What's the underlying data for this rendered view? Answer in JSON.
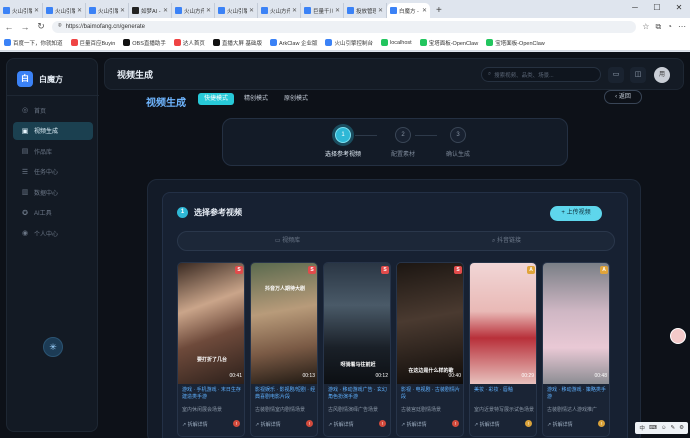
{
  "browser": {
    "tabs": [
      {
        "title": "火山引擎控制",
        "icon": "blue",
        "active": false
      },
      {
        "title": "火山引擎-你",
        "icon": "blue",
        "active": false
      },
      {
        "title": "火山引擎-你",
        "icon": "blue",
        "active": false
      },
      {
        "title": "如梦AI - 一站",
        "icon": "dark",
        "active": false
      },
      {
        "title": "火山方舟-火山",
        "icon": "blue",
        "active": false
      },
      {
        "title": "火山引擎控制",
        "icon": "blue",
        "active": false
      },
      {
        "title": "火山方舟 - A",
        "icon": "blue",
        "active": false
      },
      {
        "title": "巨量千川",
        "icon": "blue",
        "active": false
      },
      {
        "title": "投放管理",
        "icon": "blue",
        "active": false
      },
      {
        "title": "白魔方 - 电商",
        "icon": "blue",
        "active": true
      }
    ],
    "new_tab": "+",
    "url": "https://baimofang.cn/generate",
    "bookmarks": [
      "百度一下，你就知道",
      "巨量百应Buyin",
      "OBS直播助手",
      "达人首页",
      "直播大屏 基础版",
      "ArkClaw 企业版",
      "火山引擎控制台",
      "localhost",
      "宝塔面板-OpenClaw",
      "宝塔面板-OpenClaw"
    ]
  },
  "app": {
    "logo_letter": "白",
    "logo_name": "白魔方",
    "menu": [
      {
        "icon": "◎",
        "label": "首页",
        "active": false
      },
      {
        "icon": "▣",
        "label": "视频生成",
        "active": true
      },
      {
        "icon": "▤",
        "label": "作品库",
        "active": false
      },
      {
        "icon": "☰",
        "label": "任务中心",
        "active": false
      },
      {
        "icon": "▥",
        "label": "数据中心",
        "active": false
      },
      {
        "icon": "✪",
        "label": "AI工具",
        "active": false
      },
      {
        "icon": "◉",
        "label": "个人中心",
        "active": false
      }
    ],
    "header_title": "视频生成",
    "search_placeholder": "搜索视频、品类、场景...",
    "avatar_text": "用"
  },
  "main": {
    "page_title": "视频生成",
    "modes": [
      {
        "label": "快捷模式",
        "on": true
      },
      {
        "label": "精创模式",
        "on": false
      },
      {
        "label": "原创模式",
        "on": false
      }
    ],
    "back_label": "‹ 返回",
    "steps": [
      {
        "num": "1",
        "label": "选择参考视频",
        "on": true
      },
      {
        "num": "2",
        "label": "配置素材",
        "on": false
      },
      {
        "num": "3",
        "label": "确认生成",
        "on": false
      }
    ],
    "section_num": "1",
    "section_title": "选择参考视频",
    "upload_label": "+ 上传视频",
    "sources": [
      "▭ 视频库",
      "⌕ 抖音链接"
    ],
    "videos": [
      {
        "badge": "S",
        "badge_color": "#e14b4b",
        "duration": "00:41",
        "caption": "要打折了几台",
        "title": "游戏 · 手机游戏 · 末日生存建造类手游",
        "desc": "室内休闲展会场景",
        "footer": "↗ 拆解详情",
        "info_color": "#d24a3c"
      },
      {
        "badge": "S",
        "badge_color": "#e14b4b",
        "duration": "00:13",
        "caption": "抖音万人期待大剧",
        "title": "影视娱乐 · 影视剧/短剧 · 经典喜剧电影片段",
        "desc": "古装剧情室内剧情场景",
        "footer": "↗ 拆解详情",
        "info_color": "#d24a3c"
      },
      {
        "badge": "S",
        "badge_color": "#e14b4b",
        "duration": "00:12",
        "caption": "呀骑着马往前赶",
        "title": "游戏 · 移动游戏广告 · 玄幻角色扮演手游",
        "desc": "古风剧情演绎广告场景",
        "footer": "↗ 拆解详情",
        "info_color": "#d24a3c"
      },
      {
        "badge": "S",
        "badge_color": "#e14b4b",
        "duration": "00:40",
        "caption": "在这边是什么样的歌",
        "title": "影视 · 电视剧 · 古装剧情片段",
        "desc": "古装宫廷剧情场景",
        "footer": "↗ 拆解详情",
        "info_color": "#d24a3c"
      },
      {
        "badge": "A",
        "badge_color": "#e0a43a",
        "duration": "00:29",
        "caption": "",
        "title": "美妆 · 彩妆 · 唇釉",
        "desc": "室内近景特写展示试色场景",
        "footer": "↗ 拆解详情",
        "info_color": "#d9a23a"
      },
      {
        "badge": "A",
        "badge_color": "#e0a43a",
        "duration": "00:48",
        "caption": "",
        "title": "游戏 · 移动游戏 · 策略类手游",
        "desc": "古装剧情达人游戏推广",
        "footer": "↗ 拆解详情",
        "info_color": "#d9a23a"
      }
    ]
  },
  "tray": [
    "中",
    "⌨",
    "☺",
    "✎",
    "⚙"
  ]
}
